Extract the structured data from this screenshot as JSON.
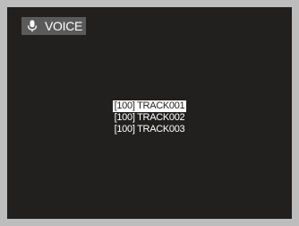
{
  "mode": {
    "label": "VOICE",
    "icon": "microphone-icon"
  },
  "tracks": [
    {
      "text": "[100] TRACK001",
      "selected": true
    },
    {
      "text": "[100] TRACK002",
      "selected": false
    },
    {
      "text": "[100] TRACK003",
      "selected": false
    }
  ],
  "colors": {
    "screen_bg": "#221f1f",
    "frame": "#bdbdbd",
    "label_bg": "#5a5a5a",
    "text": "#ffffff"
  }
}
